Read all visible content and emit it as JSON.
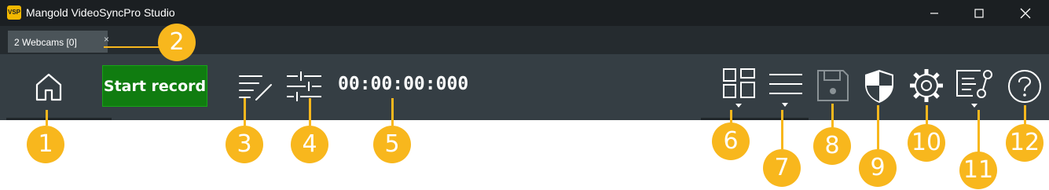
{
  "window": {
    "logo_text": "VSP",
    "title": "Mangold VideoSyncPro Studio",
    "controls": [
      "minimize-icon",
      "maximize-icon",
      "close-icon"
    ]
  },
  "tabs": [
    {
      "label": "2 Webcams [0]",
      "close_glyph": "×"
    }
  ],
  "toolbar": {
    "start_record_label": "Start record",
    "timecode": "00:00:00:000",
    "icons": [
      "home-icon",
      "edit-list-icon",
      "settings-sliders-icon",
      "layout-grid-icon",
      "list-menu-icon",
      "save-icon",
      "shield-icon",
      "gear-icon",
      "workflow-icon",
      "help-icon"
    ]
  },
  "callouts": [
    "1",
    "2",
    "3",
    "4",
    "5",
    "6",
    "7",
    "8",
    "9",
    "10",
    "11",
    "12"
  ],
  "colors": {
    "titlebar": "#1b1f22",
    "tabstrip": "#252b2f",
    "toolbar": "#353e44",
    "record_button": "#107c10",
    "callout": "#f8b71d"
  }
}
